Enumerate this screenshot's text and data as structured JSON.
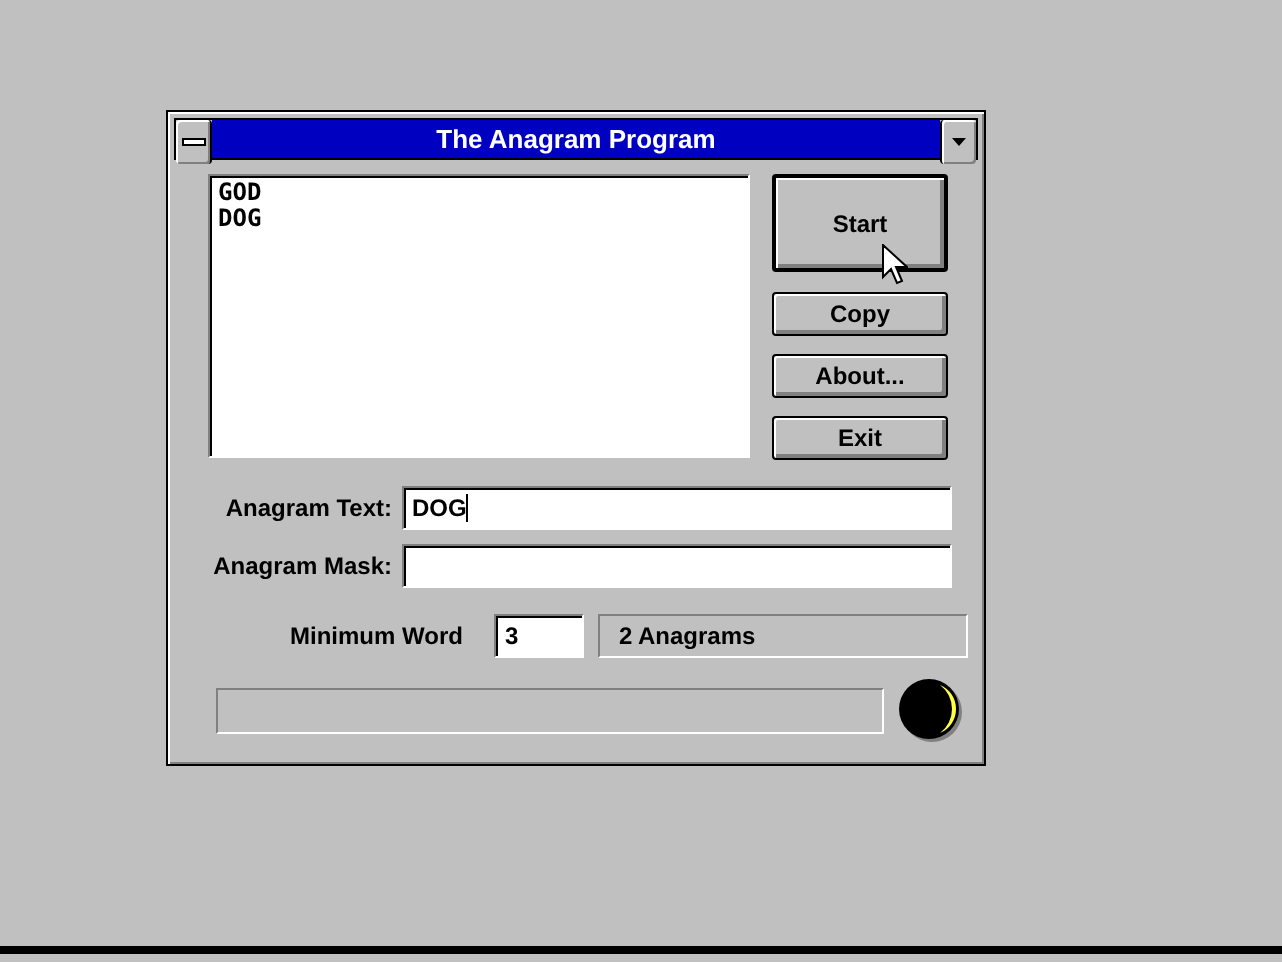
{
  "window": {
    "title": "The Anagram Program"
  },
  "results": [
    "GOD",
    "DOG"
  ],
  "buttons": [
    {
      "label": "Start",
      "default": true
    },
    {
      "label": "Copy",
      "default": false
    },
    {
      "label": "About...",
      "default": false
    },
    {
      "label": "Exit",
      "default": false
    }
  ],
  "fields": [
    {
      "label": "Anagram Text:",
      "value": "DOG",
      "focused": true
    },
    {
      "label": "Anagram Mask:",
      "focused": false
    }
  ],
  "minimum_word": {
    "label": "Minimum Word",
    "value": "3"
  },
  "status": "2 Anagrams",
  "progress": {
    "level": 0
  }
}
